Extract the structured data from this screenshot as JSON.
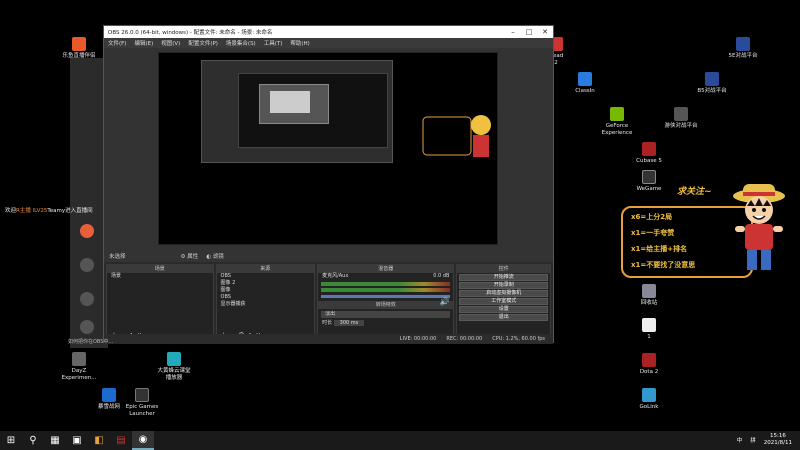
{
  "desktop": {
    "left_icons": [
      {
        "label": "乐鱼直播伴侣",
        "color": "#e85a2a"
      },
      {
        "label": "DayZ\nExperimen...",
        "color": "#666"
      },
      {
        "label": "大黄蜂云课堂\n播放器",
        "color": "#2ab"
      },
      {
        "label": "暴雪战网",
        "color": "#1a6ad0"
      },
      {
        "label": "Epic Games\nLauncher",
        "color": "#333"
      }
    ],
    "right_icons": [
      {
        "label": "5E对战平台",
        "color": "#2a4a9a"
      },
      {
        "label": "Dead\n2",
        "color": "#c33"
      },
      {
        "label": "ClassIn",
        "color": "#2a7ae0"
      },
      {
        "label": "B5对战平台",
        "color": "#2a4a9a"
      },
      {
        "label": "GeForce\nExperience",
        "color": "#76b900"
      },
      {
        "label": "游侠对战平台",
        "color": "#555"
      },
      {
        "label": "Cubase 5",
        "color": "#a22"
      },
      {
        "label": "WeGame",
        "color": "#333"
      },
      {
        "label": "回收站",
        "color": "#889"
      },
      {
        "label": "1",
        "color": "#eee"
      },
      {
        "label": "Dota 2",
        "color": "#a22"
      },
      {
        "label": "GoLink",
        "color": "#39c"
      }
    ]
  },
  "taskbar": {
    "start": "⊞",
    "search": "⚲",
    "apps": [
      "▦",
      "▣",
      "◧",
      "▤",
      "◉"
    ],
    "tray_lang": "中",
    "ime": "拼",
    "time": "15:16",
    "date": "2021/8/11"
  },
  "obs": {
    "title": "OBS 26.0.0 (64-bit, windows) - 配置文件: 未命名 - 场景: 未命名",
    "menus": [
      "文件(F)",
      "编辑(E)",
      "视图(V)",
      "配置文件(P)",
      "场景集合(S)",
      "工具(T)",
      "帮助(H)"
    ],
    "scene_bar": {
      "label": "未选择",
      "properties": "⚙ 属性",
      "filters": "◐ 滤镜"
    },
    "docks": {
      "scenes": {
        "header": "场景",
        "items": [
          "场景"
        ]
      },
      "sources": {
        "header": "来源",
        "items": [
          "OBS",
          "图像 2",
          "图像",
          "OBS",
          "显示器捕获"
        ]
      },
      "mixer": {
        "header": "混音器",
        "track": "麦克风/Aux",
        "db": "0.0 dB"
      },
      "transitions": {
        "header": "转场特效",
        "type": "淡出",
        "duration_label": "时长",
        "duration": "300 ms"
      },
      "controls": {
        "header": "控件",
        "buttons": [
          "开始推流",
          "开始录制",
          "启动虚拟摄像机",
          "工作室模式",
          "设置",
          "退出"
        ]
      }
    },
    "status": {
      "live": "LIVE: 00:00:00",
      "rec": "REC: 00:00:00",
      "cpu": "CPU: 1.2%, 60.00 fps"
    }
  },
  "overlay": {
    "notification_prefix": "欢迎",
    "notification_user": "R主播 lLV25",
    "notification_suffix": "Teamy进入直播间",
    "notification2": "如何把你在OBS中..."
  },
  "sticker": {
    "title": "求关注~",
    "lines": [
      "x6=上分2局",
      "x1=一手夸赞",
      "x1=给主播+排名",
      "x1=不要找了没意思"
    ]
  }
}
